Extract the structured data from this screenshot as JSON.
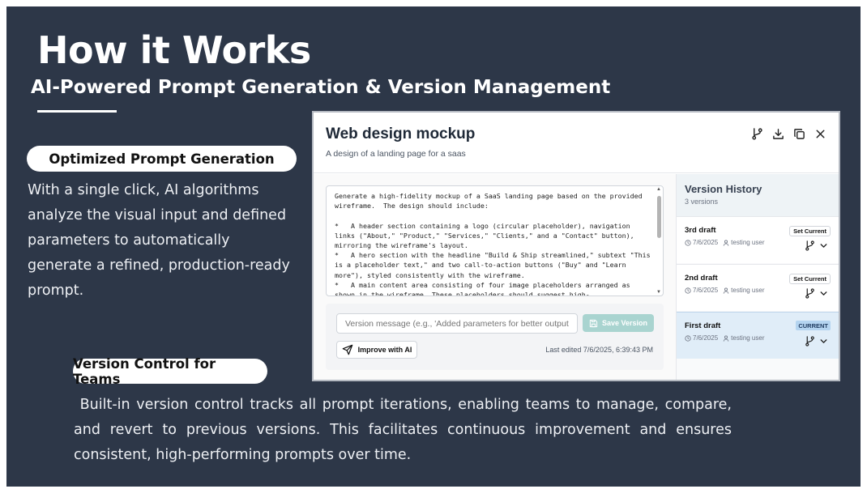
{
  "slide": {
    "title": "How it Works",
    "subtitle": "AI-Powered Prompt Generation & Version Management",
    "section1": {
      "heading": "Optimized Prompt Generation",
      "body": "With a single click, AI algorithms analyze the visual input and defined parameters to automatically generate a refined, production-ready prompt."
    },
    "section2": {
      "heading": "Version Control for Teams",
      "body": " Built-in version control tracks all prompt iterations, enabling teams to manage, compare, and revert to previous versions. This facilitates continuous improvement and ensures consistent, high-performing prompts over time."
    }
  },
  "app": {
    "title": "Web design mockup",
    "description": "A design of a landing page for a saas",
    "header_icons": [
      "branch-icon",
      "download-icon",
      "copy-icon",
      "close-icon"
    ],
    "prompt_text": "Generate a high-fidelity mockup of a SaaS landing page based on the provided wireframe.  The design should include:\n\n*   A header section containing a logo (circular placeholder), navigation links (\"About,\" \"Product,\" \"Services,\" \"Clients,\" and a \"Contact\" button), mirroring the wireframe's layout.\n*   A hero section with the headline \"Build & Ship streamlined,\" subtext \"This is a placeholder text,\" and two call-to-action buttons (\"Buy\" and \"Learn more\"), styled consistently with the wireframe.\n*   A main content area consisting of four image placeholders arranged as shown in the wireframe. These placeholders should suggest high-",
    "version_placeholder": "Version message (e.g., 'Added parameters for better output')",
    "save_label": "Save Version",
    "improve_label": "Improve with AI",
    "last_edited": "Last edited 7/6/2025, 6:39:43 PM",
    "accent_color": "#a9d4d0"
  },
  "history": {
    "title": "Version History",
    "count": "3 versions",
    "versions": [
      {
        "name": "3rd draft",
        "date": "7/6/2025",
        "user": "testing user",
        "action": "Set Current"
      },
      {
        "name": "2nd draft",
        "date": "7/6/2025",
        "user": "testing user",
        "action": "Set Current"
      },
      {
        "name": "First draft",
        "date": "7/6/2025",
        "user": "testing user",
        "badge": "CURRENT"
      }
    ]
  }
}
